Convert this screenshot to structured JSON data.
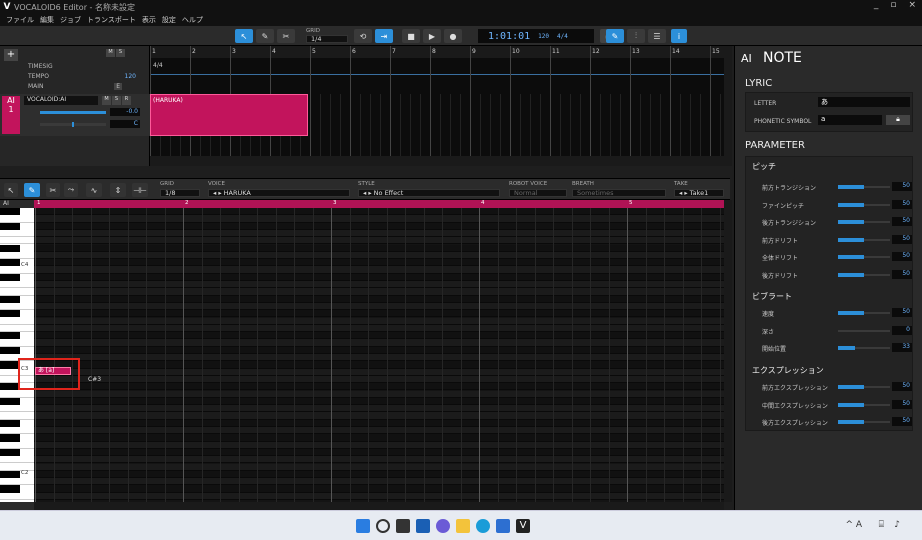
{
  "window": {
    "title": "VOCALOID6 Editor - 名称未設定",
    "logo": "V",
    "controls": [
      "_",
      "▫",
      "×"
    ]
  },
  "menu": [
    "ファイル",
    "編集",
    "ジョブ",
    "トランスポート",
    "表示",
    "設定",
    "ヘルプ"
  ],
  "toolbar": {
    "grid_label": "GRID",
    "grid_value": "1/4",
    "time": "1:01:01",
    "tempo": "120",
    "timesig": "4/4"
  },
  "tracks": {
    "labels": [
      "TIMESIG",
      "TEMPO",
      "MAIN"
    ],
    "timesig_value": "4/4",
    "tempo_value": "120",
    "track_name": "VOCALOID:AI",
    "track_number": "1",
    "ai_badge": "AI",
    "vol_value": "-0.0",
    "pan_value": "C",
    "mute": "M",
    "solo": "S",
    "rec": "R",
    "m_btn": "M",
    "s_btn": "S",
    "e_btn": "E"
  },
  "arrangement": {
    "measures": [
      "1",
      "2",
      "3",
      "4",
      "5",
      "6",
      "7",
      "8",
      "9",
      "10",
      "11",
      "12",
      "13",
      "14",
      "15"
    ],
    "part_name": "(HARUKA)"
  },
  "editor": {
    "grid_label": "GRID",
    "grid_value": "1/8",
    "voice_label": "VOICE",
    "voice_value": "HARUKA",
    "style_label": "STYLE",
    "style_value": "No Effect",
    "robot_label": "ROBOT VOICE",
    "robot_value": "Normal",
    "breath_label": "BREATH",
    "breath_value": "Sometimes",
    "take_label": "TAKE",
    "take_value": "Take1",
    "ai_badge": "AI",
    "measures": [
      "1",
      "2",
      "3",
      "4",
      "5"
    ],
    "key_labels": [
      "C4",
      "C3",
      "C2"
    ],
    "note_text": "あ [a]",
    "pitch_label": "C#3"
  },
  "panel": {
    "ai": "AI",
    "title": "NOTE",
    "lyric_header": "LYRIC",
    "letter_label": "LETTER",
    "letter_value": "あ",
    "phonetic_label": "PHONETIC SYMBOL",
    "phonetic_value": "a",
    "parameter_header": "PARAMETER",
    "pitch_group": "ピッチ",
    "pitch_rows": [
      {
        "name": "前方トランジション",
        "value": "50",
        "level": 0.5
      },
      {
        "name": "ファインピッチ",
        "value": "50",
        "level": 0.5
      },
      {
        "name": "後方トランジション",
        "value": "50",
        "level": 0.5
      },
      {
        "name": "前方ドリフト",
        "value": "50",
        "level": 0.5
      },
      {
        "name": "全体ドリフト",
        "value": "50",
        "level": 0.5
      },
      {
        "name": "後方ドリフト",
        "value": "50",
        "level": 0.5
      }
    ],
    "vibrato_group": "ビブラート",
    "vibrato_rows": [
      {
        "name": "速度",
        "value": "50",
        "level": 0.5
      },
      {
        "name": "深さ",
        "value": "0",
        "level": 0.0
      },
      {
        "name": "開始位置",
        "value": "33",
        "level": 0.33
      }
    ],
    "expression_group": "エクスプレッション",
    "expression_rows": [
      {
        "name": "前方エクスプレッション",
        "value": "50",
        "level": 0.5
      },
      {
        "name": "中間エクスプレッション",
        "value": "50",
        "level": 0.5
      },
      {
        "name": "後方エクスプレッション",
        "value": "50",
        "level": 0.5
      }
    ]
  },
  "taskbar": {
    "tray": "^ A"
  },
  "colors": {
    "accent": "#2c8fd9",
    "part": "#c2145c",
    "highlight": "#e0241b"
  }
}
